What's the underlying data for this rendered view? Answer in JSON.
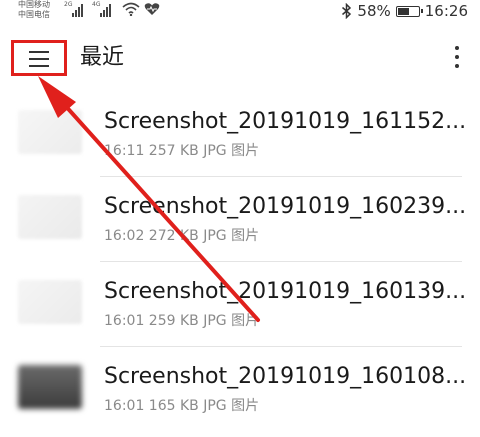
{
  "status_bar": {
    "carrier_1": "中国移动",
    "carrier_2": "中国电信",
    "net_1": "2G",
    "net_2": "4G",
    "battery_label": "58%",
    "battery_level": 0.58,
    "time": "16:26"
  },
  "toolbar": {
    "title": "最近",
    "menu_icon": "hamburger-menu-icon",
    "more_icon": "more-vertical-icon",
    "highlight_color": "#e0201c"
  },
  "files": [
    {
      "name": "Screenshot_20191019_161152...",
      "meta": "16:11  257 KB  JPG  图片"
    },
    {
      "name": "Screenshot_20191019_160239...",
      "meta": "16:02  272 KB  JPG  图片"
    },
    {
      "name": "Screenshot_20191019_160139...",
      "meta": "16:01  259 KB  JPG  图片"
    },
    {
      "name": "Screenshot_20191019_160108...",
      "meta": "16:01  165 KB  JPG  图片"
    }
  ],
  "annotation": {
    "arrow_color": "#e0201c"
  }
}
